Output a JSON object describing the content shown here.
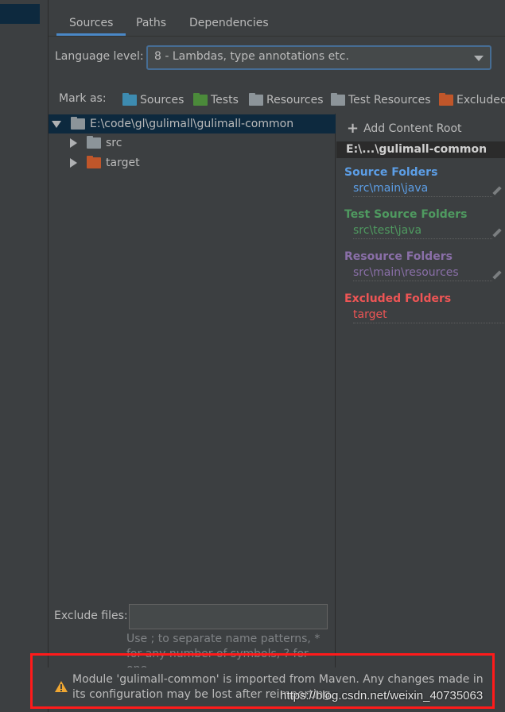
{
  "tabs": [
    {
      "label": "Sources",
      "active": true
    },
    {
      "label": "Paths"
    },
    {
      "label": "Dependencies"
    }
  ],
  "language": {
    "label": "Language level:",
    "value": "8 - Lambdas, type annotations etc."
  },
  "mark_as": {
    "label": "Mark as:",
    "items": [
      {
        "label": "Sources",
        "color": "#3d8bb0"
      },
      {
        "label": "Tests",
        "color": "#4b8a3a"
      },
      {
        "label": "Resources",
        "color": "#8c9499"
      },
      {
        "label": "Test Resources",
        "color": "#8c9499"
      },
      {
        "label": "Excluded",
        "color": "#c0562a"
      }
    ]
  },
  "tree": {
    "root": "E:\\code\\gl\\gulimall\\gulimall-common",
    "children": [
      {
        "label": "src",
        "color": "#8c9499"
      },
      {
        "label": "target",
        "color": "#c0562a"
      }
    ]
  },
  "right": {
    "add_root": "Add Content Root",
    "root_title": "E:\\...\\gulimall-common",
    "sections": [
      {
        "title": "Source Folders",
        "path": "src\\main\\java",
        "color": "#5c9ee6"
      },
      {
        "title": "Test Source Folders",
        "path": "src\\test\\java",
        "color": "#4f9a60"
      },
      {
        "title": "Resource Folders",
        "path": "src\\main\\resources",
        "color": "#8a6fa8"
      },
      {
        "title": "Excluded Folders",
        "path": "target",
        "color": "#ee5555"
      }
    ]
  },
  "exclude": {
    "label": "Exclude files:",
    "value": "",
    "hint": "Use ; to separate name patterns, * for any number of symbols, ? for one."
  },
  "warning": {
    "text": "Module 'gulimall-common' is imported from Maven. Any changes made in its configuration may be lost after reimporting."
  },
  "watermark": "https://blog.csdn.net/weixin_40735063"
}
